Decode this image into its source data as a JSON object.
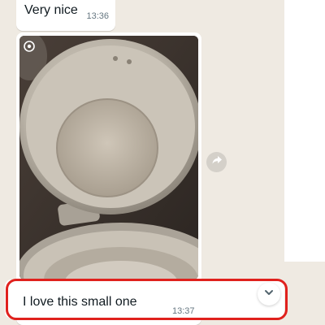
{
  "conversation": {
    "messages": [
      {
        "text": "Very nice",
        "time": "13:36"
      },
      {
        "type": "image",
        "image_subject": "aluminium pots stacked on a stove",
        "view_once_icon": "view-once-icon"
      },
      {
        "text": "I love this small one",
        "time": "13:37"
      }
    ]
  },
  "icons": {
    "forward": "forward-icon",
    "scroll_down": "chevron-down-icon"
  },
  "colors": {
    "chat_background": "#efeae2",
    "bubble": "#ffffff",
    "timestamp": "#667781",
    "highlight": "#e0211d"
  }
}
